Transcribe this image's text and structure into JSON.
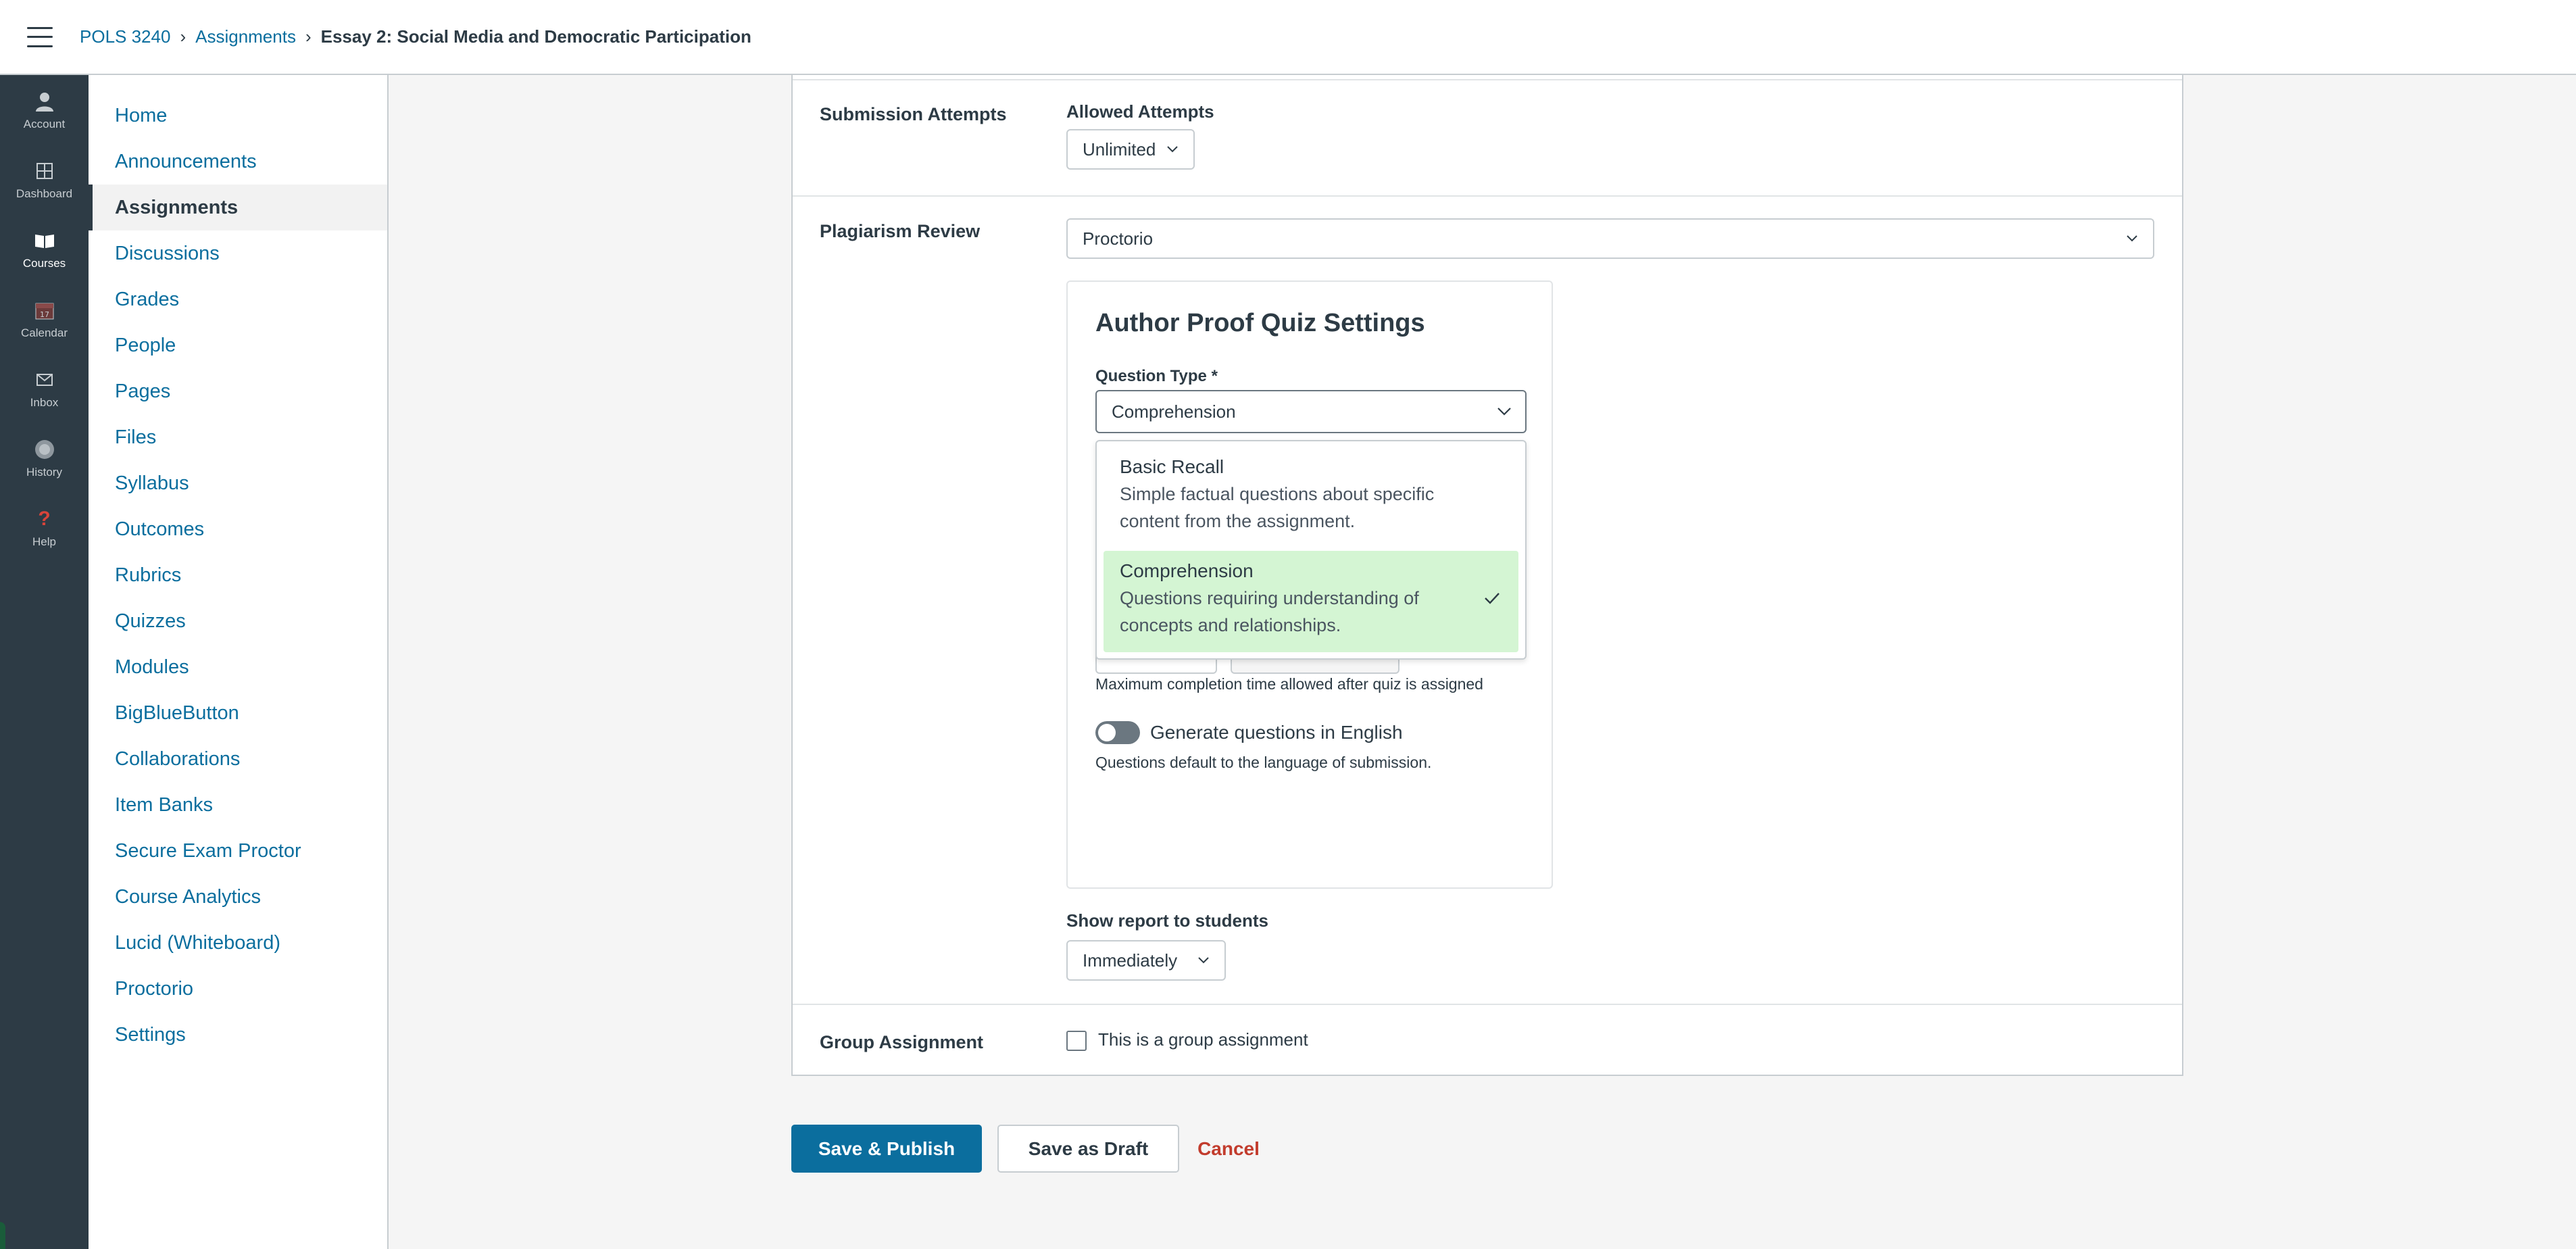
{
  "breadcrumb": {
    "course": "POLS 3240",
    "section": "Assignments",
    "current": "Essay 2: Social Media and Democratic Participation"
  },
  "global_nav": [
    {
      "label": "Account",
      "icon": "account-icon"
    },
    {
      "label": "Dashboard",
      "icon": "dashboard-icon"
    },
    {
      "label": "Courses",
      "icon": "courses-icon"
    },
    {
      "label": "Calendar",
      "icon": "calendar-icon"
    },
    {
      "label": "Inbox",
      "icon": "inbox-icon"
    },
    {
      "label": "History",
      "icon": "history-icon"
    },
    {
      "label": "Help",
      "icon": "help-icon"
    }
  ],
  "course_nav": [
    "Home",
    "Announcements",
    "Assignments",
    "Discussions",
    "Grades",
    "People",
    "Pages",
    "Files",
    "Syllabus",
    "Outcomes",
    "Rubrics",
    "Quizzes",
    "Modules",
    "BigBlueButton",
    "Collaborations",
    "Item Banks",
    "Secure Exam Proctor",
    "Course Analytics",
    "Lucid (Whiteboard)",
    "Proctorio",
    "Settings"
  ],
  "submission_attempts": {
    "label": "Submission Attempts",
    "allowed_label": "Allowed Attempts",
    "allowed_value": "Unlimited"
  },
  "plagiarism": {
    "label": "Plagiarism Review",
    "value": "Proctorio"
  },
  "quiz_settings": {
    "title": "Author Proof Quiz Settings",
    "question_type_label": "Question Type *",
    "question_type_value": "Comprehension",
    "options": [
      {
        "title": "Basic Recall",
        "desc": "Simple factual questions about specific content from the assignment."
      },
      {
        "title": "Comprehension",
        "desc": "Questions requiring understanding of concepts and relationships."
      }
    ],
    "time_helper": "Maximum completion time allowed after quiz is assigned",
    "toggle_label": "Generate questions in English",
    "toggle_helper": "Questions default to the language of submission."
  },
  "show_report": {
    "label": "Show report to students",
    "value": "Immediately"
  },
  "group": {
    "label": "Group Assignment",
    "checkbox_label": "This is a group assignment"
  },
  "actions": {
    "save_publish": "Save & Publish",
    "save_draft": "Save as Draft",
    "cancel": "Cancel"
  },
  "colors": {
    "link": "#0b6e9e",
    "primary": "#0b6e9e",
    "cancel": "#c23c2d",
    "selected_option": "#d4f5d3",
    "global_nav_bg": "#2d3b45"
  }
}
